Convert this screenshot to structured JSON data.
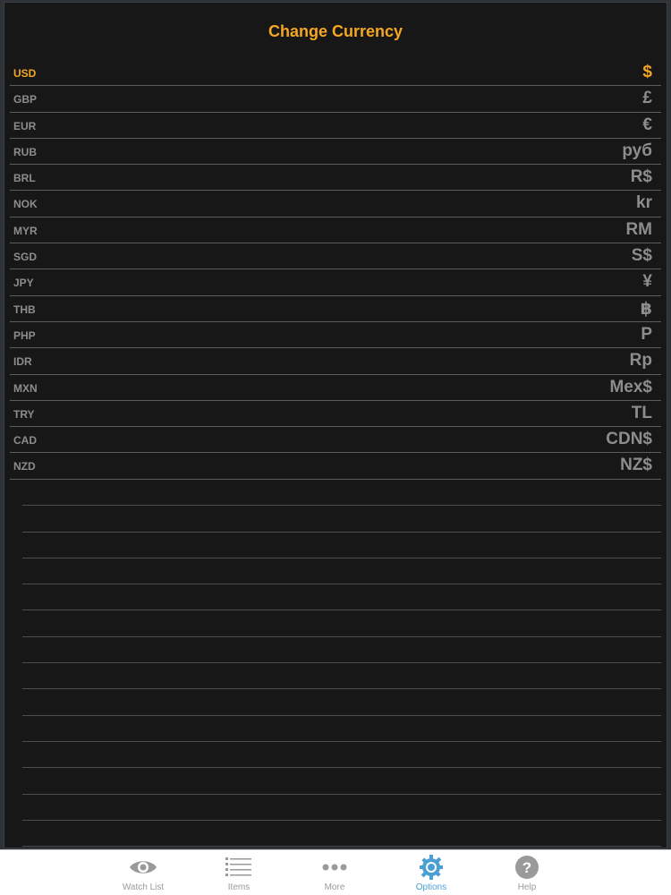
{
  "title": "Change Currency",
  "currencies": [
    {
      "code": "USD",
      "symbol": "$"
    },
    {
      "code": "GBP",
      "symbol": "£"
    },
    {
      "code": "EUR",
      "symbol": "€"
    },
    {
      "code": "RUB",
      "symbol": "руб"
    },
    {
      "code": "BRL",
      "symbol": "R$"
    },
    {
      "code": "NOK",
      "symbol": "kr"
    },
    {
      "code": "MYR",
      "symbol": "RM"
    },
    {
      "code": "SGD",
      "symbol": "S$"
    },
    {
      "code": "JPY",
      "symbol": "¥"
    },
    {
      "code": "THB",
      "symbol": "฿"
    },
    {
      "code": "PHP",
      "symbol": "P"
    },
    {
      "code": "IDR",
      "symbol": "Rp"
    },
    {
      "code": "MXN",
      "symbol": "Mex$"
    },
    {
      "code": "TRY",
      "symbol": "TL"
    },
    {
      "code": "CAD",
      "symbol": "CDN$"
    },
    {
      "code": "NZD",
      "symbol": "NZ$"
    }
  ],
  "selected_currency": "USD",
  "tabs": [
    {
      "label": "Watch List",
      "icon": "eye-icon"
    },
    {
      "label": "Items",
      "icon": "list-icon"
    },
    {
      "label": "More",
      "icon": "more-dots-icon"
    },
    {
      "label": "Options",
      "icon": "gear-icon"
    },
    {
      "label": "Help",
      "icon": "help-icon"
    }
  ],
  "active_tab": "Options",
  "colors": {
    "accent": "#f5a623",
    "inactive_text": "#8d8d8d",
    "active_tab": "#4a9fd5",
    "inactive_tab": "#9a9a9a",
    "panel_background": "#171717"
  }
}
